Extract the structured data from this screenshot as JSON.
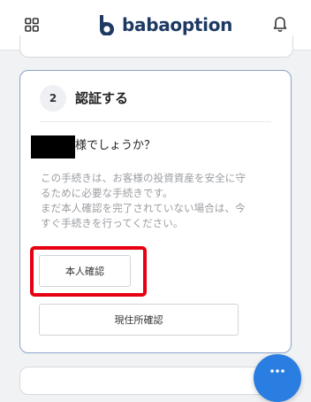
{
  "header": {
    "logo_text": "babaoption",
    "menu_icon": "grid-icon",
    "notification_icon": "bell-icon"
  },
  "step": {
    "number": "2",
    "title": "認証する",
    "question_suffix": "様でしょうか？",
    "description": [
      "この手続きは、お客様の投資資産を安全に守",
      "るために必要な手続きです。",
      "まだ本人確認を完了されていない場合は、今",
      "すぐ手続きを行ってください。"
    ],
    "identity_button_label": "本人確認",
    "address_button_label": "現住所確認"
  },
  "colors": {
    "brand": "#1e3a63",
    "card_border": "#8aa3c7",
    "highlight": "#e60012",
    "fab": "#2a7de1"
  },
  "chat": {
    "icon": "chat-icon"
  }
}
